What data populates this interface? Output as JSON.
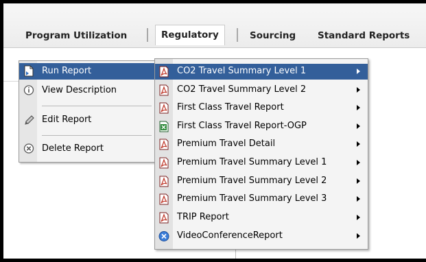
{
  "tabs": [
    {
      "label": "Program Utilization"
    },
    {
      "label": "Regulatory"
    },
    {
      "label": "Sourcing"
    },
    {
      "label": "Standard Reports"
    }
  ],
  "context_menu": {
    "items": [
      {
        "label": "Run Report",
        "icon": "run-report-icon"
      },
      {
        "label": "View Description",
        "icon": "info-icon"
      },
      {
        "label": "Edit Report",
        "icon": "pencil-icon"
      },
      {
        "label": "Delete Report",
        "icon": "delete-icon"
      }
    ]
  },
  "submenu": {
    "items": [
      {
        "label": "CO2 Travel Summary Level 1",
        "icon": "pdf-report-icon"
      },
      {
        "label": "CO2 Travel Summary Level 2",
        "icon": "pdf-report-icon"
      },
      {
        "label": "First Class Travel Report",
        "icon": "pdf-report-icon"
      },
      {
        "label": "First Class Travel Report-OGP",
        "icon": "excel-report-icon"
      },
      {
        "label": "Premium Travel Detail",
        "icon": "pdf-report-icon"
      },
      {
        "label": "Premium Travel Summary Level 1",
        "icon": "pdf-report-icon"
      },
      {
        "label": "Premium Travel Summary Level 2",
        "icon": "pdf-report-icon"
      },
      {
        "label": "Premium Travel Summary Level 3",
        "icon": "pdf-report-icon"
      },
      {
        "label": "TRIP Report",
        "icon": "pdf-report-icon"
      },
      {
        "label": "VideoConferenceReport",
        "icon": "video-conference-icon"
      }
    ]
  },
  "colors": {
    "selection": "#335f9a",
    "pdf_red": "#c0392b",
    "excel_green": "#2e8b3a",
    "video_blue": "#3b7dd8"
  }
}
